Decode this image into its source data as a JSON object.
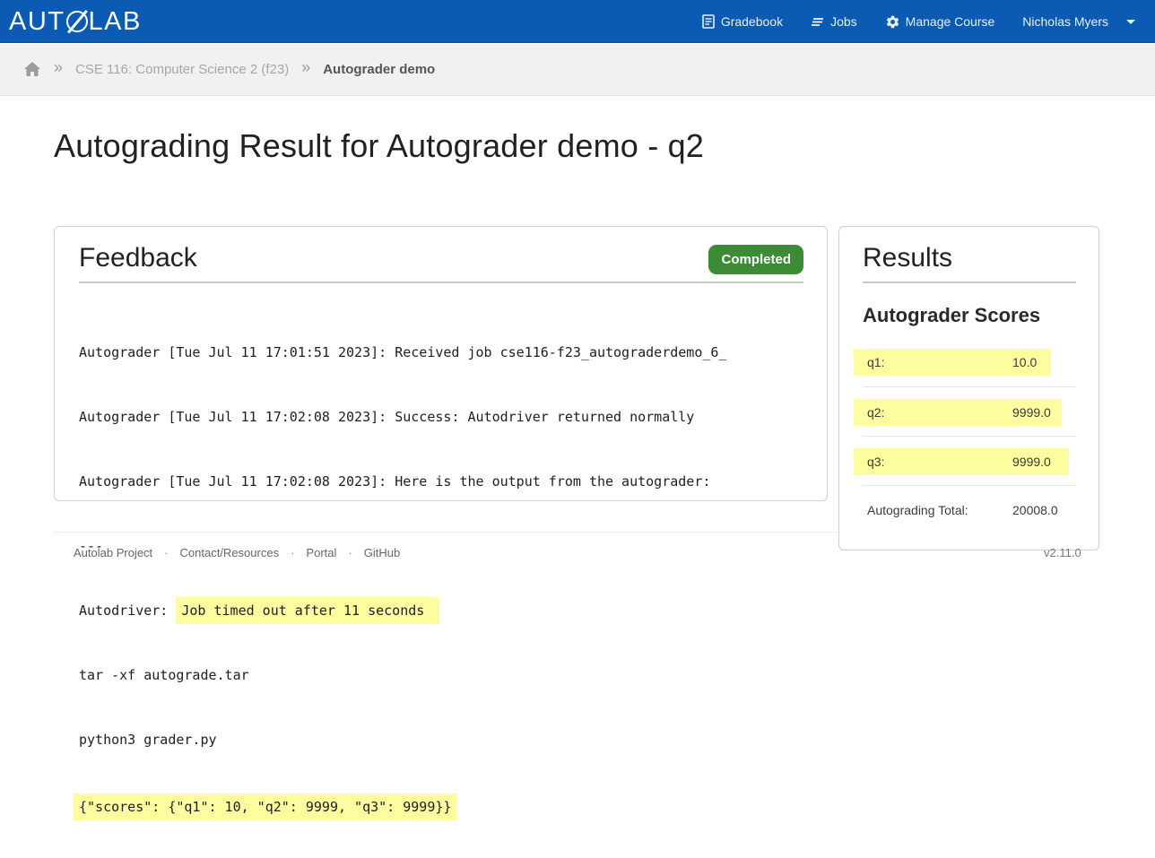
{
  "navbar": {
    "logo_left": "AUT",
    "logo_right": "LAB",
    "items": [
      {
        "label": "Gradebook",
        "icon": "gradebook-icon"
      },
      {
        "label": "Jobs",
        "icon": "jobs-icon"
      },
      {
        "label": "Manage Course",
        "icon": "gear-icon"
      }
    ],
    "user": "Nicholas Myers"
  },
  "breadcrumb": {
    "course": "CSE 116: Computer Science 2 (f23)",
    "current": "Autograder demo"
  },
  "page": {
    "title": "Autograding Result for Autograder demo - q2"
  },
  "feedback": {
    "title": "Feedback",
    "status": "Completed",
    "status_color": "#3c8c35",
    "lines": [
      "Autograder [Tue Jul 11 17:01:51 2023]: Received job cse116-f23_autograderdemo_6_",
      "Autograder [Tue Jul 11 17:02:08 2023]: Success: Autodriver returned normally",
      "Autograder [Tue Jul 11 17:02:08 2023]: Here is the output from the autograder:",
      "---"
    ],
    "autodriver_prefix": "Autodriver:",
    "autodriver_message": "Job timed out after 11 seconds",
    "cmd1": "tar -xf autograde.tar",
    "cmd2": "python3 grader.py",
    "scores_json": "{\"scores\": {\"q1\": 10, \"q2\": 9999, \"q3\": 9999}}"
  },
  "results": {
    "title": "Results",
    "subtitle": "Autograder Scores",
    "scores": [
      {
        "label": "q1:",
        "value": "10.0"
      },
      {
        "label": "q2:",
        "value": "9999.0"
      },
      {
        "label": "q3:",
        "value": "9999.0"
      }
    ],
    "total_label": "Autograding Total:",
    "total_value": "20008.0"
  },
  "footer": {
    "links": [
      "Autolab Project",
      "Contact/Resources",
      "Portal",
      "GitHub"
    ],
    "version": "v2.11.0"
  },
  "colors": {
    "navbar": "#0b5bb4",
    "highlight": "#fdfd9f",
    "badge": "#3c8c35"
  }
}
